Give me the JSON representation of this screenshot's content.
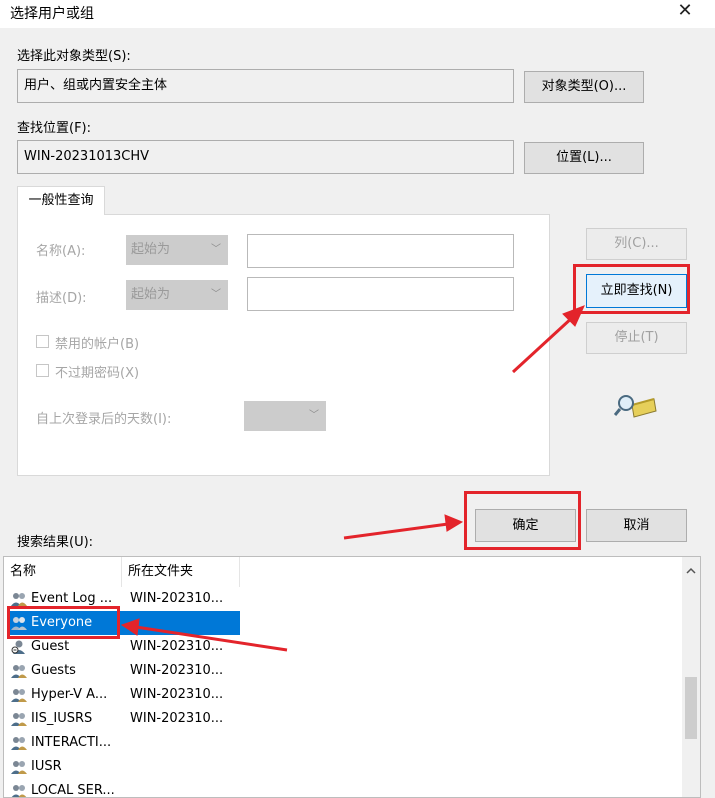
{
  "window": {
    "title": "选择用户或组",
    "close_glyph": "✕"
  },
  "object_types": {
    "label": "选择此对象类型(S):",
    "value": "用户、组或内置安全主体",
    "button": "对象类型(O)..."
  },
  "location": {
    "label": "查找位置(F):",
    "value": "WIN-20231013CHV",
    "button": "位置(L)..."
  },
  "query": {
    "tab_label": "一般性查询",
    "name_label": "名称(A):",
    "name_mode": "起始为",
    "desc_label": "描述(D):",
    "desc_mode": "起始为",
    "disabled_accounts_label": "禁用的帐户(B)",
    "non_expiring_label": "不过期密码(X)",
    "days_label": "自上次登录后的天数(I):"
  },
  "buttons": {
    "columns": "列(C)...",
    "find_now": "立即查找(N)",
    "stop": "停止(T)",
    "ok": "确定",
    "cancel": "取消"
  },
  "results": {
    "label": "搜索结果(U):",
    "col_name": "名称",
    "col_folder": "所在文件夹",
    "rows": [
      {
        "name": "Event Log ...",
        "folder": "WIN-202310..."
      },
      {
        "name": "Everyone",
        "folder": ""
      },
      {
        "name": "Guest",
        "folder": "WIN-202310..."
      },
      {
        "name": "Guests",
        "folder": "WIN-202310..."
      },
      {
        "name": "Hyper-V A...",
        "folder": "WIN-202310..."
      },
      {
        "name": "IIS_IUSRS",
        "folder": "WIN-202310..."
      },
      {
        "name": "INTERACTI...",
        "folder": ""
      },
      {
        "name": "IUSR",
        "folder": ""
      },
      {
        "name": "LOCAL SER...",
        "folder": ""
      }
    ],
    "selected_row": "Everyone"
  },
  "colors": {
    "annotation_red": "#e3242b",
    "selection_blue": "#0078d7"
  }
}
